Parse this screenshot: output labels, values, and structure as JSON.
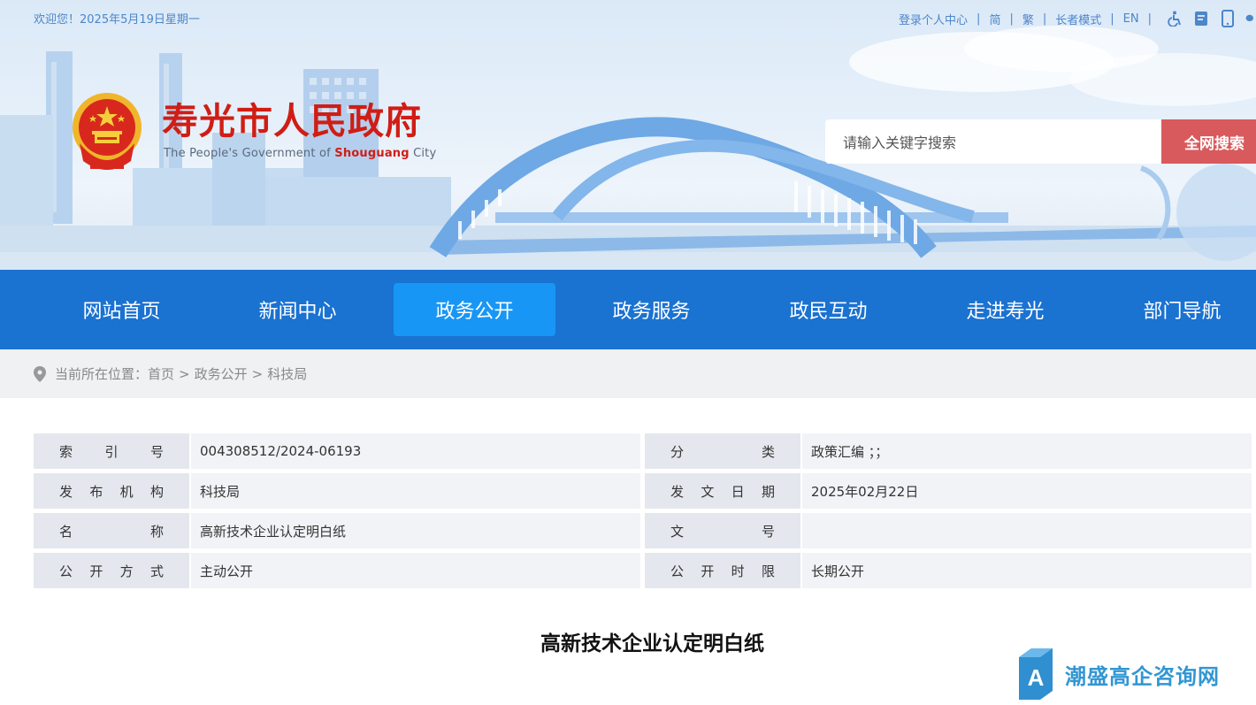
{
  "topbar": {
    "greeting": "欢迎您！2025年5月19日星期一",
    "links": [
      "登录个人中心",
      "简",
      "繁",
      "长者模式",
      "EN"
    ],
    "icons": [
      "accessibility-icon",
      "note-icon",
      "mobile-icon",
      "wechat-icon"
    ]
  },
  "header": {
    "title": "寿光市人民政府",
    "subtitle_prefix": "The People's Government of ",
    "subtitle_highlight": "Shouguang",
    "subtitle_suffix": " City"
  },
  "search": {
    "placeholder": "请输入关键字搜索",
    "button": "全网搜索"
  },
  "nav": {
    "items": [
      "网站首页",
      "新闻中心",
      "政务公开",
      "政务服务",
      "政民互动",
      "走进寿光",
      "部门导航"
    ],
    "active": "政务公开"
  },
  "breadcrumb": {
    "prefix": "当前所在位置：",
    "items": [
      "首页",
      "政务公开",
      "科技局"
    ],
    "separator": ">"
  },
  "info": {
    "rows": [
      {
        "l1": [
          "索",
          "引",
          "号"
        ],
        "v1": "004308512/2024-06193",
        "l2": [
          "分",
          "类"
        ],
        "v2": "政策汇编 ；；"
      },
      {
        "l1": [
          "发",
          "布",
          "机",
          "构"
        ],
        "v1": "科技局",
        "l2": [
          "发",
          "文",
          "日",
          "期"
        ],
        "v2": "2025年02月22日"
      },
      {
        "l1": [
          "名",
          "称"
        ],
        "v1": "高新技术企业认定明白纸",
        "l2": [
          "文",
          "号"
        ],
        "v2": ""
      },
      {
        "l1": [
          "公",
          "开",
          "方",
          "式"
        ],
        "v1": "主动公开",
        "l2": [
          "公",
          "开",
          "时",
          "限"
        ],
        "v2": "长期公开"
      }
    ]
  },
  "document": {
    "title": "高新技术企业认定明白纸"
  },
  "watermark": {
    "text": "潮盛高企咨询网",
    "logo_letter": "A"
  },
  "colors": {
    "nav_bg": "#1a72d1",
    "nav_active": "#1896f5",
    "brand_red": "#d01d15",
    "search_button": "#d95a5c",
    "link_blue": "#4d86c9"
  }
}
